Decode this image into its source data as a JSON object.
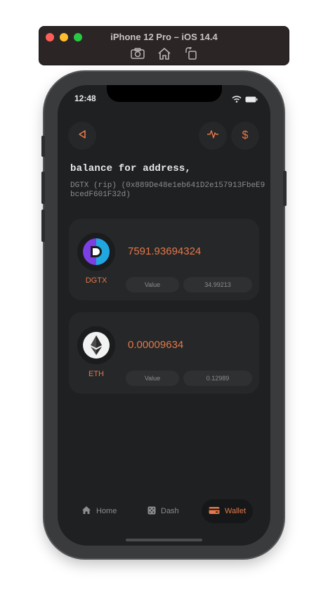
{
  "simulator": {
    "title": "iPhone 12 Pro – iOS 14.4",
    "tools": [
      "camera-icon",
      "home-icon",
      "rotate-icon"
    ]
  },
  "status": {
    "time": "12:48"
  },
  "header": {
    "back_icon": "triangle-left-icon",
    "activity_icon": "pulse-icon",
    "price_icon": "dollar-icon",
    "price_glyph": "$"
  },
  "page": {
    "title": "balance for address,",
    "address": "DGTX (rip) (0x889De48e1eb641D2e157913FbeE9bcedF601F32d)"
  },
  "assets": [
    {
      "symbol": "DGTX",
      "amount": "7591.93694324",
      "value_label": "Value",
      "value": "34.99213",
      "icon": "dgtx-logo"
    },
    {
      "symbol": "ETH",
      "amount": "0.00009634",
      "value_label": "Value",
      "value": "0.12989",
      "icon": "ethereum-logo"
    }
  ],
  "tabs": [
    {
      "label": "Home",
      "icon": "house-icon",
      "active": false
    },
    {
      "label": "Dash",
      "icon": "dice-icon",
      "active": false
    },
    {
      "label": "Wallet",
      "icon": "wallet-icon",
      "active": true
    }
  ],
  "colors": {
    "accent": "#e6784a",
    "background": "#1e2021",
    "card": "#252728"
  }
}
